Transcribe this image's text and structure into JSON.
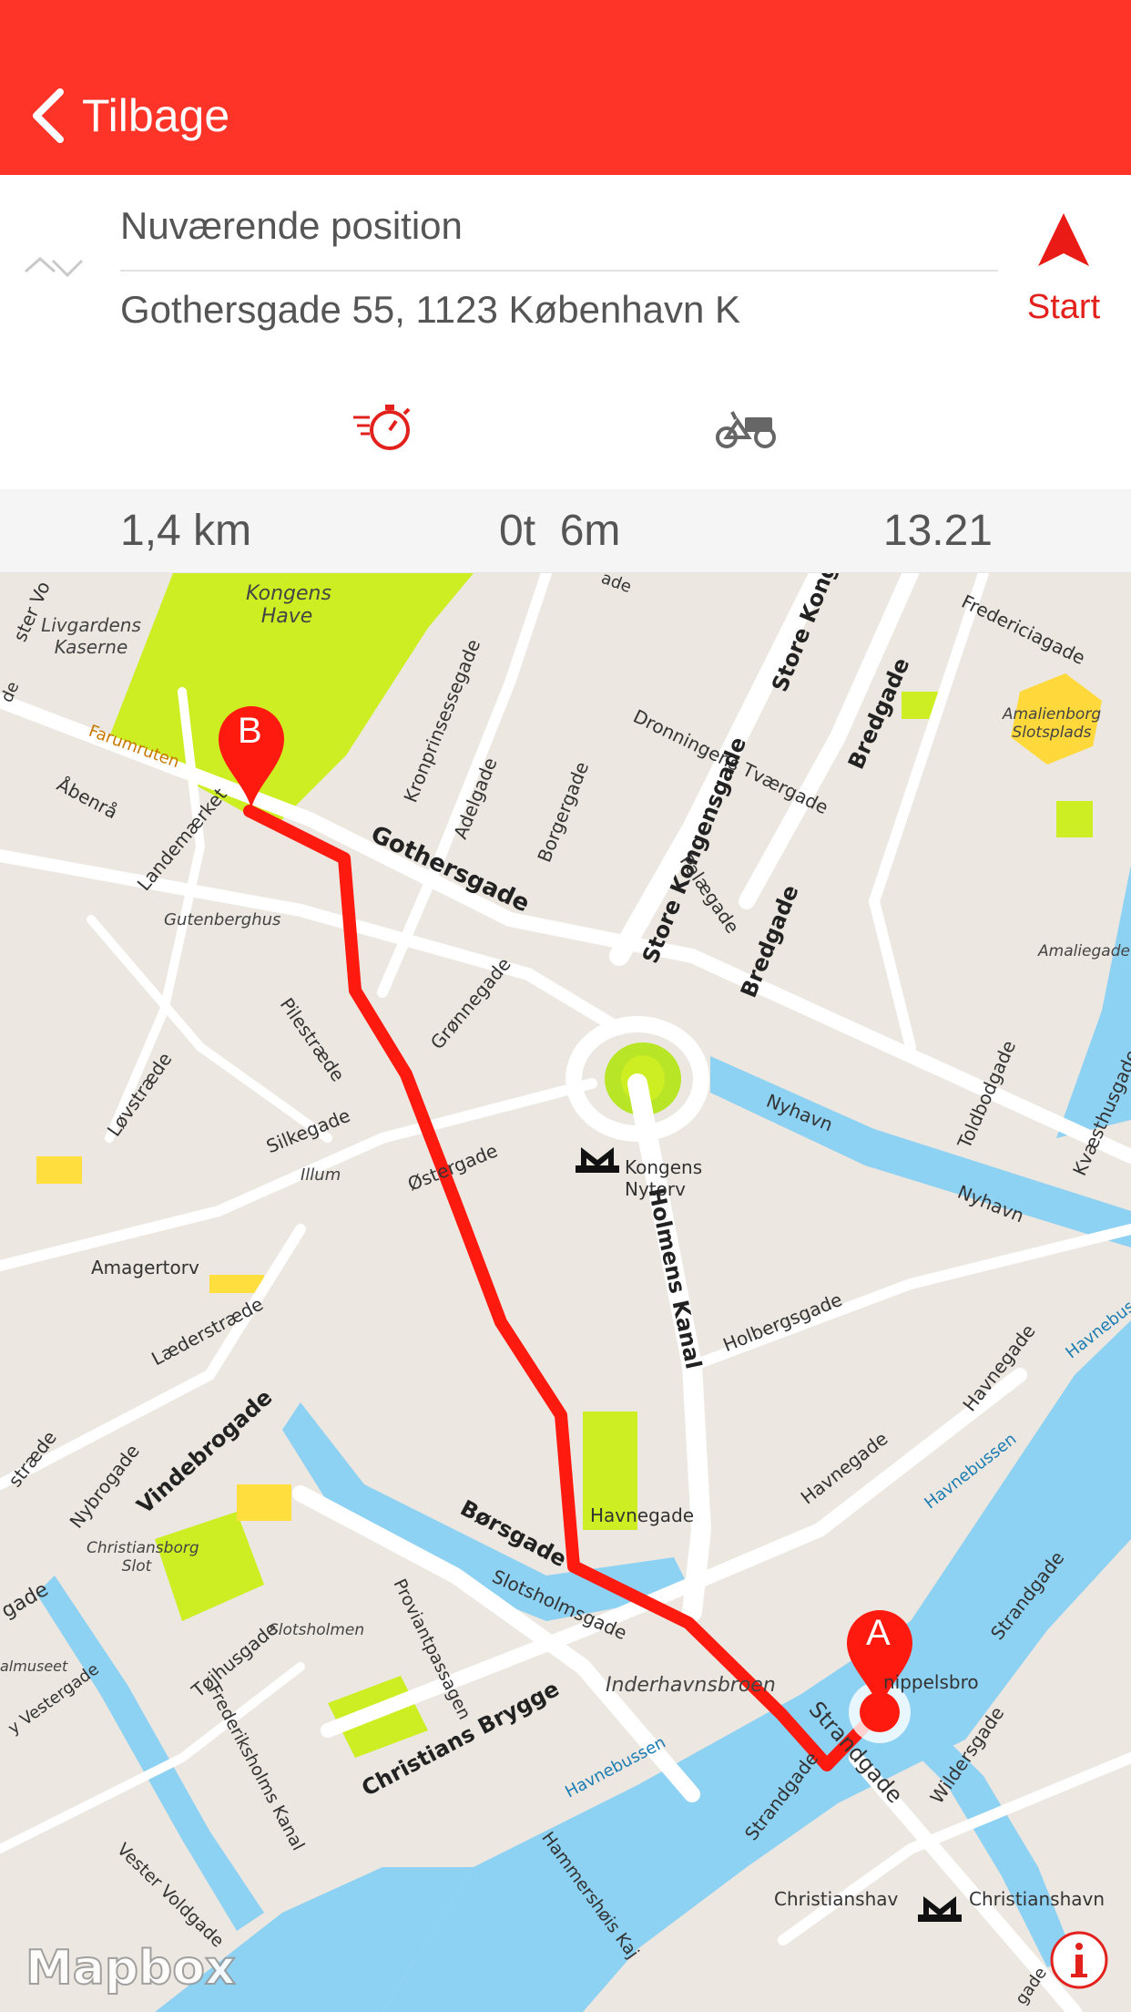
{
  "header": {
    "back_label": "Tilbage",
    "color": "#ff3429"
  },
  "route_form": {
    "from": "Nuværende position",
    "to": "Gothersgade 55, 1123 København K",
    "start_label": "Start"
  },
  "modes": [
    {
      "icon": "stopwatch-icon",
      "selected": true
    },
    {
      "icon": "cargo-bike-icon",
      "selected": false
    }
  ],
  "summary": {
    "distance": "1,4 km",
    "duration": "0t  6m",
    "arrival": "13.21"
  },
  "map": {
    "marker_start": "A",
    "marker_end": "B",
    "route_color": "#ff1a10",
    "attribution": "Mapbox",
    "labels": {
      "kongens_have": "Kongens Have",
      "livgardens": "Livgardens Kaserne",
      "farumruten": "Farumruten",
      "abenra": "Åbenrå",
      "landemaerket": "Landemærket",
      "gutenberghus": "Gutenberghus",
      "kronprinsessegade": "Kronprinsessegade",
      "adelgade": "Adelgade",
      "borgergade": "Borgergade",
      "store_kongensgade_a": "Store Kong",
      "dronningens": "Dronningens Tværgade",
      "bredgade_a": "Bredgade",
      "fredericiagade": "Fredericiagade",
      "amalienborg": "Amalienborg Slotsplads",
      "amaliegade": "Amaliegade",
      "gothersgade": "Gothersgade",
      "store_kongensgade_b": "Store Kongensgade",
      "palaegade": "Palægade",
      "bredgade_b": "Bredgade",
      "pilestraede": "Pilestræde",
      "gronnegade": "Grønnegade",
      "lovstraede": "Løvstræde",
      "silkegade": "Silkegade",
      "illum": "Illum",
      "ostergade": "Østergade",
      "kongens_nytorv": "Kongens Nytorv",
      "nyhavn_a": "Nyhavn",
      "nyhavn_b": "Nyhavn",
      "toldbodgade": "Toldbodgade",
      "kvaesthusgade": "Kvæsthusgade",
      "amagertorv": "Amagertorv",
      "laederstraede": "Læderstræde",
      "holmens_kanal": "Holmens Kanal",
      "holbergsgade": "Holbergsgade",
      "havnegade_a": "Havnegade",
      "havnegade_b": "Havnegade",
      "havnegade_c": "Havnegade",
      "havnebussen_a": "Havnebussen",
      "havnebussen_b": "Havnebussen",
      "havnebussen_c": "Havnebussen",
      "vindebrogade": "Vindebrogade",
      "nybrogade": "Nybrogade",
      "straede": "stræde",
      "christiansborg": "Christiansborg Slot",
      "borsgade": "Børsgade",
      "slotsholmsgade": "Slotsholmsgade",
      "slotsholmen": "Slotsholmen",
      "tojhusgade": "Tøjhusgade",
      "proviantpassagen": "Proviantpassagen",
      "inderhavnsbroen": "Inderhavnsbroen",
      "knippelsbro": "nippelsbro",
      "strandgade_a": "Strandgade",
      "strandgade_b": "Strandgade",
      "strandgade_c": "Strandgade",
      "wildersgade": "Wildersgade",
      "christians_brygge": "Christians Brygge",
      "frederiksholms_kanal": "Frederiksholms Kanal",
      "vester_voldgade": "Vester Voldgade",
      "hammershois": "Hammershøis Kaj",
      "christianshavn_a": "Christianshav",
      "christianshavn_b": "Christianshavn",
      "gade": "gade",
      "almuseet": "almuseet",
      "vestergade": "y Vestergade",
      "ster_vo": "ster Vo",
      "ade": "ade",
      "oe": "de",
      "gade_b": "gade"
    }
  }
}
